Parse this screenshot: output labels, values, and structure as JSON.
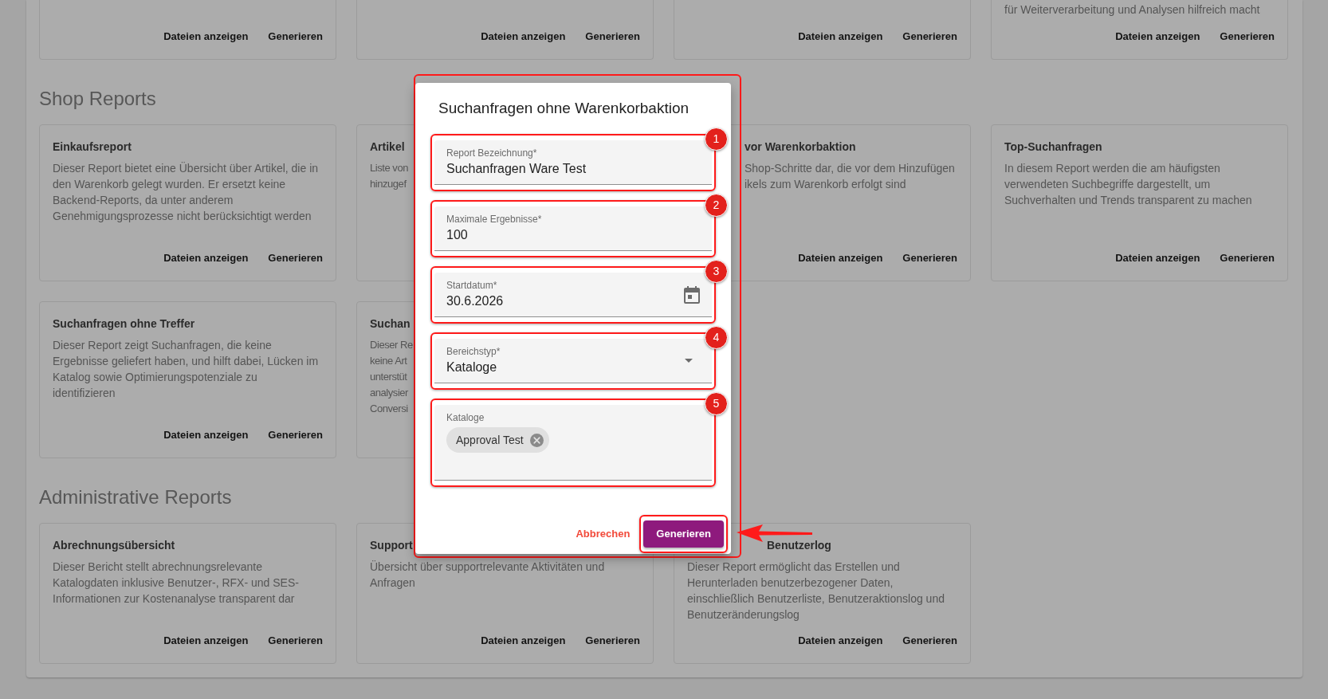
{
  "sections": [
    {
      "cards": [
        {
          "kind": "cut_top",
          "buttons": [
            "Dateien anzeigen",
            "Generieren"
          ]
        },
        {
          "kind": "cut_top",
          "buttons": [
            "Dateien anzeigen",
            "Generieren"
          ]
        },
        {
          "kind": "cut_top",
          "buttons": [
            "Dateien anzeigen",
            "Generieren"
          ]
        },
        {
          "kind": "cut_top",
          "description": "für Weiterverarbeitung und Analysen hilfreich macht",
          "buttons": [
            "Dateien anzeigen",
            "Generieren"
          ]
        }
      ]
    },
    {
      "heading": "Shop Reports",
      "cards": [
        {
          "kind": "plain",
          "title": "Einkaufsreport",
          "description": "Dieser Report bietet eine Übersicht über Artikel, die in den Warenkorb gelegt wurden. Er ersetzt keine Backend-Reports, da unter anderem Genehmigungsprozesse nicht berücksichtigt werden",
          "buttons": [
            "Dateien anzeigen",
            "Generieren"
          ]
        },
        {
          "kind": "plain",
          "title": "Artikel",
          "description_lines": [
            "Liste von",
            "hinzugef"
          ]
        },
        {
          "kind": "indented",
          "title": "vor Warenkorbaktion",
          "description_lines": [
            "Shop-Schritte dar, die vor dem Hinzufügen",
            "ikels zum Warenkorb erfolgt sind"
          ],
          "buttons": [
            "Dateien anzeigen",
            "Generieren"
          ]
        },
        {
          "kind": "plain",
          "title": "Top-Suchanfragen",
          "description": "In diesem Report werden die am häufigsten verwendeten Suchbegriffe dargestellt, um Suchverhalten und Trends transparent zu machen",
          "buttons": [
            "Dateien anzeigen",
            "Generieren"
          ]
        },
        {
          "kind": "plain",
          "title": "Suchanfragen ohne Treffer",
          "description": "Dieser Report zeigt Suchanfragen, die keine Ergebnisse geliefert haben, und hilft dabei, Lücken im Katalog sowie Optimierungspotenziale zu identifizieren",
          "buttons": [
            "Dateien anzeigen",
            "Generieren"
          ]
        },
        {
          "kind": "plain",
          "title": "Suchan",
          "description_lines": [
            "Dieser Re",
            "keine Art",
            "unterstüt",
            "analysier",
            "Conversi"
          ]
        }
      ]
    },
    {
      "heading": "Administrative Reports",
      "cards": [
        {
          "kind": "plain",
          "title": "Abrechnungsübersicht",
          "description": "Dieser Bericht stellt abrechnungsrelevante Katalogdaten inklusive Benutzer-, RFX- und SES-Informationen zur Kostenanalyse transparent dar",
          "buttons": [
            "Dateien anzeigen",
            "Generieren"
          ]
        },
        {
          "kind": "plain",
          "title": "Support",
          "description": "Übersicht über supportrelevante Aktivitäten und Anfragen",
          "buttons": [
            "Dateien anzeigen",
            "Generieren"
          ]
        },
        {
          "kind": "title_indented",
          "title": "Benutzerlog",
          "description": "Dieser Report ermöglicht das Erstellen und Herunterladen benutzerbezogener Daten, einschließlich Benutzerliste, Benutzeraktionslog und Benutzeränderungslog",
          "buttons": [
            "Dateien anzeigen",
            "Generieren"
          ]
        }
      ]
    }
  ],
  "dialog": {
    "title": "Suchanfragen ohne Warenkorbaktion",
    "highlighted": true,
    "fields": [
      {
        "kind": "text",
        "label": "Report Bezeichnung*",
        "value": "Suchanfragen Ware Test",
        "marker": "1"
      },
      {
        "kind": "text",
        "label": "Maximale Ergebnisse*",
        "value": "100",
        "marker": "2"
      },
      {
        "kind": "date",
        "label": "Startdatum*",
        "value": "30.6.2026",
        "marker": "3"
      },
      {
        "kind": "select",
        "label": "Bereichstyp*",
        "value": "Kataloge",
        "marker": "4"
      },
      {
        "kind": "chips",
        "label": "Kataloge",
        "chips": [
          "Approval Test"
        ],
        "marker": "5"
      }
    ],
    "actions": [
      {
        "kind": "text",
        "label": "Abbrechen"
      },
      {
        "kind": "contained",
        "label": "Generieren",
        "highlighted": true,
        "arrow": true
      }
    ]
  }
}
